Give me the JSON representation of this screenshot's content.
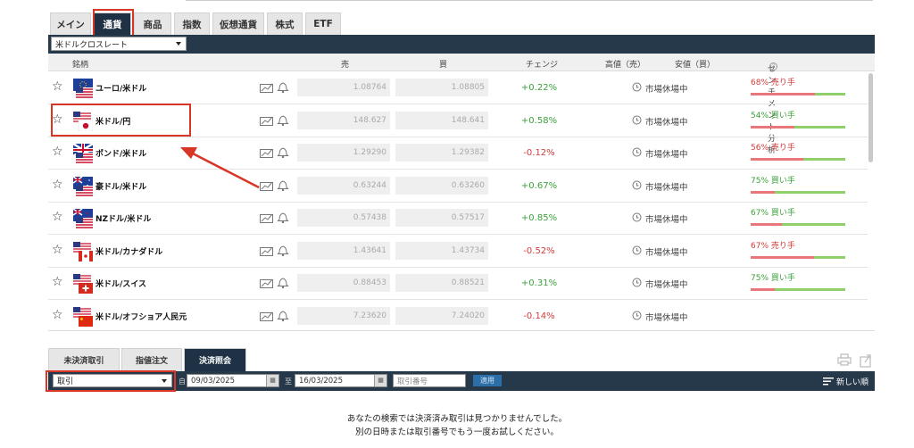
{
  "top_tabs": [
    "メイン",
    "通貨",
    "商品",
    "指数",
    "仮想通貨",
    "株式",
    "ETF"
  ],
  "instrument_select": "米ドルクロスレート",
  "columns": {
    "symbol": "銘柄",
    "sell": "売",
    "buy": "買",
    "change": "チェンジ",
    "high": "高値（売）",
    "low": "安値（買）",
    "sentiment": "センチメント分析"
  },
  "rows": [
    {
      "name": "ユーロ/米ドル",
      "sell": "1.08764",
      "buy": "1.08805",
      "change": "+0.22%",
      "status": "市場休場中",
      "sentiment": "68%  売り手",
      "sell_pct": 68
    },
    {
      "name": "米ドル/円",
      "sell": "148.627",
      "buy": "148.641",
      "change": "+0.58%",
      "status": "市場休場中",
      "sentiment": "54%  買い手",
      "sell_pct": 46
    },
    {
      "name": "ポンド/米ドル",
      "sell": "1.29290",
      "buy": "1.29382",
      "change": "-0.12%",
      "status": "市場休場中",
      "sentiment": "56%  売り手",
      "sell_pct": 56
    },
    {
      "name": "豪ドル/米ドル",
      "sell": "0.63244",
      "buy": "0.63260",
      "change": "+0.67%",
      "status": "市場休場中",
      "sentiment": "75%  買い手",
      "sell_pct": 25
    },
    {
      "name": "NZドル/米ドル",
      "sell": "0.57438",
      "buy": "0.57517",
      "change": "+0.85%",
      "status": "市場休場中",
      "sentiment": "67%  買い手",
      "sell_pct": 33
    },
    {
      "name": "米ドル/カナダドル",
      "sell": "1.43641",
      "buy": "1.43734",
      "change": "-0.52%",
      "status": "市場休場中",
      "sentiment": "67%  売り手",
      "sell_pct": 67
    },
    {
      "name": "米ドル/スイス",
      "sell": "0.88453",
      "buy": "0.88521",
      "change": "+0.31%",
      "status": "市場休場中",
      "sentiment": "75%  買い手",
      "sell_pct": 25
    },
    {
      "name": "米ドル/オフショア人民元",
      "sell": "7.23620",
      "buy": "7.24020",
      "change": "-0.14%",
      "status": "市場休場中",
      "sentiment": "",
      "sell_pct": null
    }
  ],
  "bottom_tabs": [
    "未決済取引",
    "指値注文",
    "決済照会"
  ],
  "filter": {
    "type": "取引",
    "from_label": "自",
    "from_date": "09/03/2025",
    "to_label": "至",
    "to_date": "16/03/2025",
    "trade_no_placeholder": "取引番号",
    "apply": "適用",
    "sort": "新しい順"
  },
  "message_line1": "あなたの検索では決済済み取引は見つかりませんでした。",
  "message_line2": "別の日時または取引番号でもう一度お試しください。",
  "colors": {
    "accent_dark": "#26394b",
    "positive": "#3aa13a",
    "negative": "#d23b3b",
    "highlight": "#d93526"
  }
}
